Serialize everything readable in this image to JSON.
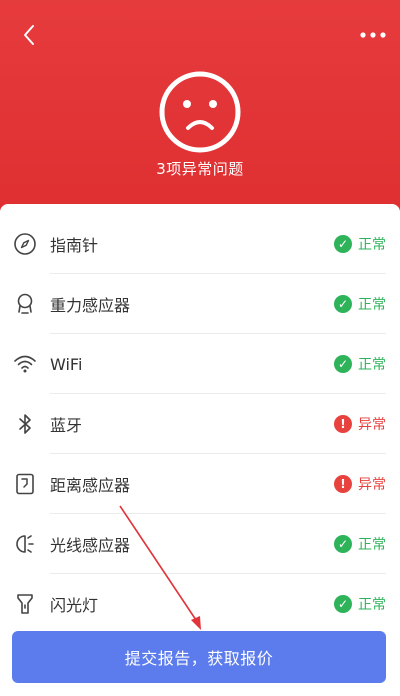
{
  "header": {
    "title": "3项异常问题",
    "background": "#e2353a"
  },
  "items": [
    {
      "icon": "compass-icon",
      "label": "指南针",
      "status": "正常",
      "state": "ok"
    },
    {
      "icon": "gravity-sensor-icon",
      "label": "重力感应器",
      "status": "正常",
      "state": "ok"
    },
    {
      "icon": "wifi-icon",
      "label": "WiFi",
      "status": "正常",
      "state": "ok"
    },
    {
      "icon": "bluetooth-icon",
      "label": "蓝牙",
      "status": "异常",
      "state": "bad"
    },
    {
      "icon": "proximity-sensor-icon",
      "label": "距离感应器",
      "status": "异常",
      "state": "bad"
    },
    {
      "icon": "light-sensor-icon",
      "label": "光线感应器",
      "status": "正常",
      "state": "ok"
    },
    {
      "icon": "flashlight-icon",
      "label": "闪光灯",
      "status": "正常",
      "state": "ok"
    }
  ],
  "submit": {
    "label": "提交报告，获取报价",
    "color": "#5c7bec"
  },
  "colors": {
    "ok": "#2eb35a",
    "bad": "#e8423f"
  }
}
